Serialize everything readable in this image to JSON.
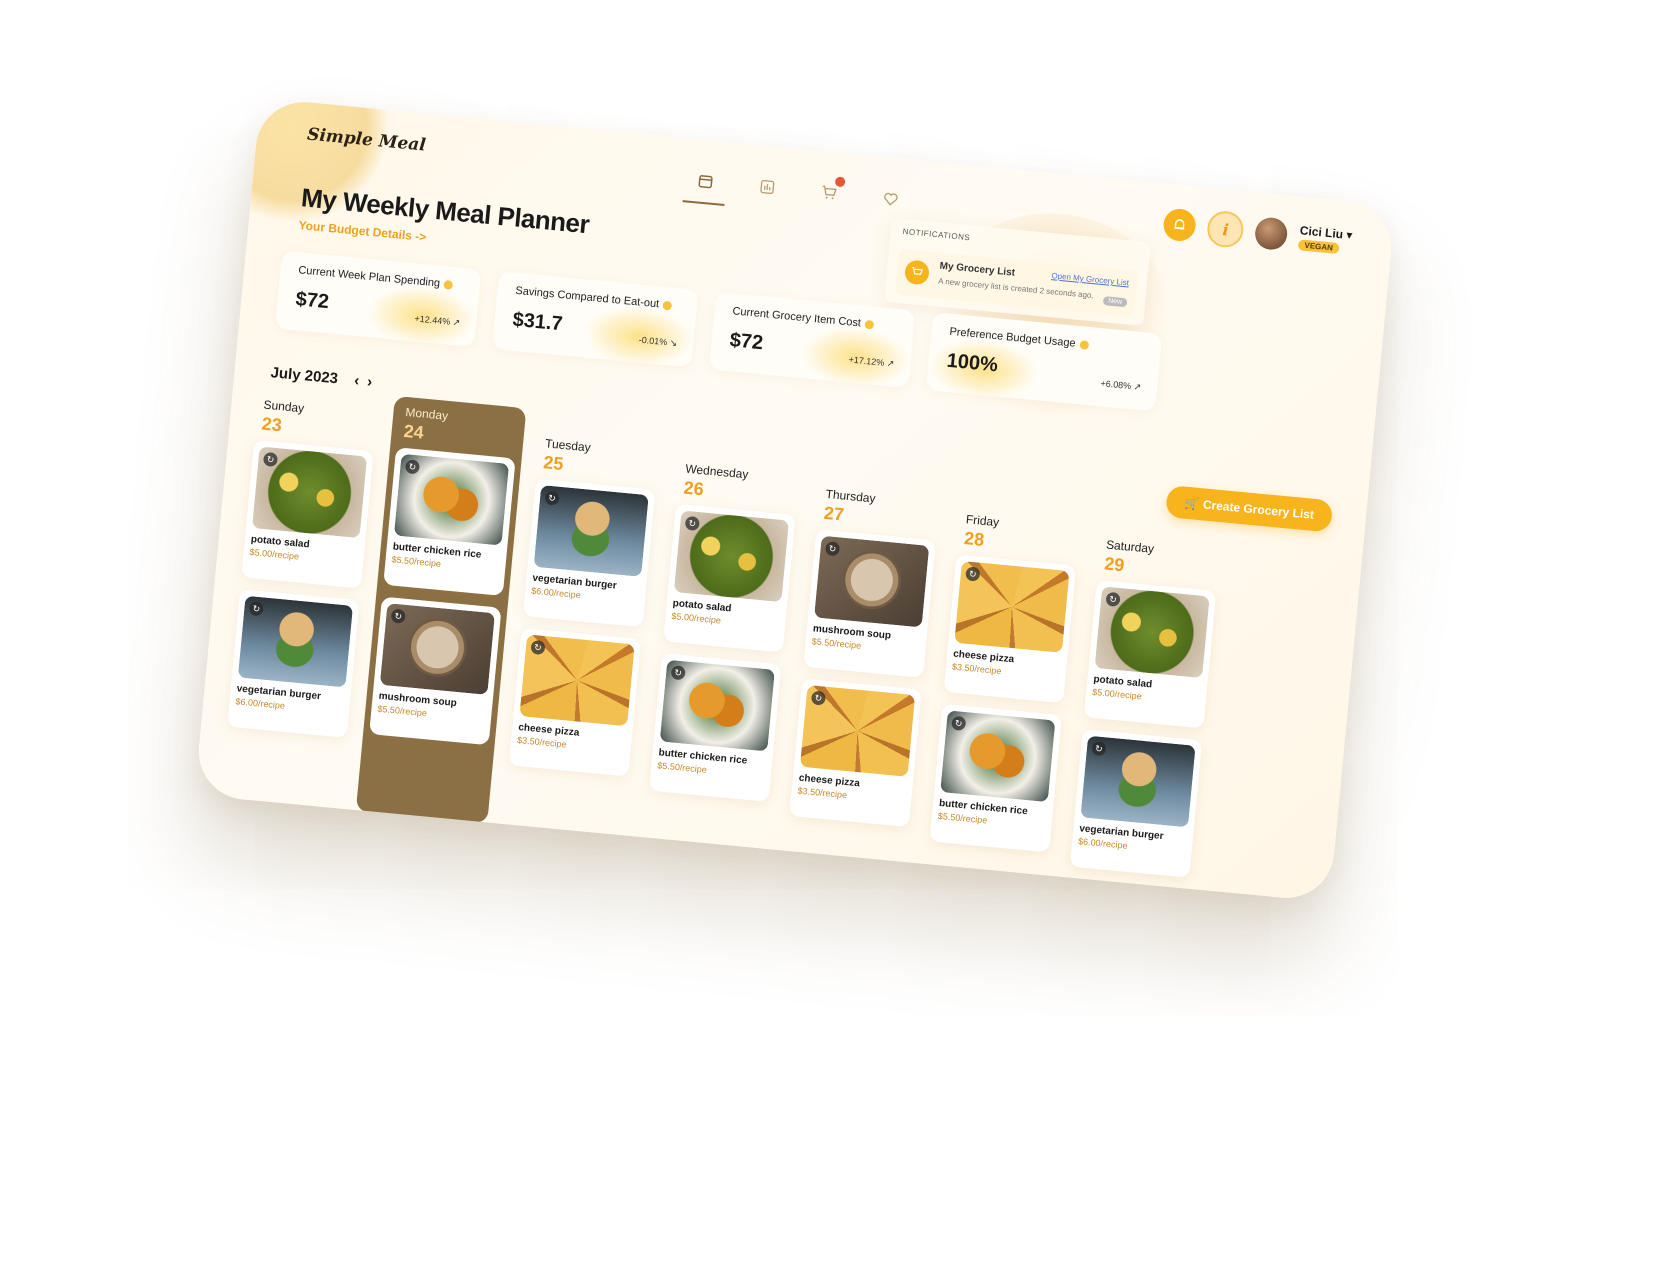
{
  "app": {
    "logo": "Simple Meal"
  },
  "nav": {
    "items": [
      {
        "icon": "calendar-icon",
        "active": true
      },
      {
        "icon": "chart-icon",
        "active": false
      },
      {
        "icon": "cart-icon",
        "active": false,
        "badge": true
      },
      {
        "icon": "heart-icon",
        "active": false
      }
    ]
  },
  "user": {
    "name": "Cici Liu",
    "badge": "VEGAN"
  },
  "notifications": {
    "header": "NOTIFICATIONS",
    "items": [
      {
        "title": "My Grocery List",
        "description": "A new grocery list is created 2 seconds ago.",
        "link": "Open My Grocery List",
        "tag": "New"
      }
    ]
  },
  "page": {
    "title": "My Weekly Meal Planner",
    "budget_link": "Your Budget Details ->"
  },
  "stats": [
    {
      "label": "Current Week Plan Spending",
      "value": "$72",
      "change": "+12.44%"
    },
    {
      "label": "Savings Compared to Eat-out",
      "value": "$31.7",
      "change": "-0.01%"
    },
    {
      "label": "Current Grocery Item Cost",
      "value": "$72",
      "change": "+17.12%"
    },
    {
      "label": "Preference Budget Usage",
      "value": "100%",
      "change": "+6.08%"
    }
  ],
  "calendar": {
    "month": "July 2023",
    "prev": "‹",
    "next": "›"
  },
  "create_button": "Create Grocery List",
  "days": [
    {
      "name": "Sunday",
      "date": "23",
      "meals": [
        {
          "name": "potato salad",
          "price": "$5.00/recipe",
          "img": "salad"
        },
        {
          "name": "vegetarian burger",
          "price": "$6.00/recipe",
          "img": "burger"
        }
      ]
    },
    {
      "name": "Monday",
      "date": "24",
      "active": true,
      "meals": [
        {
          "name": "butter chicken rice",
          "price": "$5.50/recipe",
          "img": "chicken"
        },
        {
          "name": "mushroom soup",
          "price": "$5.50/recipe",
          "img": "soup"
        }
      ]
    },
    {
      "name": "Tuesday",
      "date": "25",
      "meals": [
        {
          "name": "vegetarian burger",
          "price": "$6.00/recipe",
          "img": "burger"
        },
        {
          "name": "cheese pizza",
          "price": "$3.50/recipe",
          "img": "pizza"
        }
      ]
    },
    {
      "name": "Wednesday",
      "date": "26",
      "meals": [
        {
          "name": "potato salad",
          "price": "$5.00/recipe",
          "img": "salad"
        },
        {
          "name": "butter chicken rice",
          "price": "$5.50/recipe",
          "img": "chicken"
        }
      ]
    },
    {
      "name": "Thursday",
      "date": "27",
      "meals": [
        {
          "name": "mushroom soup",
          "price": "$5.50/recipe",
          "img": "soup"
        },
        {
          "name": "cheese pizza",
          "price": "$3.50/recipe",
          "img": "pizza"
        }
      ]
    },
    {
      "name": "Friday",
      "date": "28",
      "meals": [
        {
          "name": "cheese pizza",
          "price": "$3.50/recipe",
          "img": "pizza"
        },
        {
          "name": "butter chicken rice",
          "price": "$5.50/recipe",
          "img": "chicken"
        }
      ]
    },
    {
      "name": "Saturday",
      "date": "29",
      "meals": [
        {
          "name": "potato salad",
          "price": "$5.00/recipe",
          "img": "salad"
        },
        {
          "name": "vegetarian burger",
          "price": "$6.00/recipe",
          "img": "burger"
        }
      ]
    }
  ]
}
